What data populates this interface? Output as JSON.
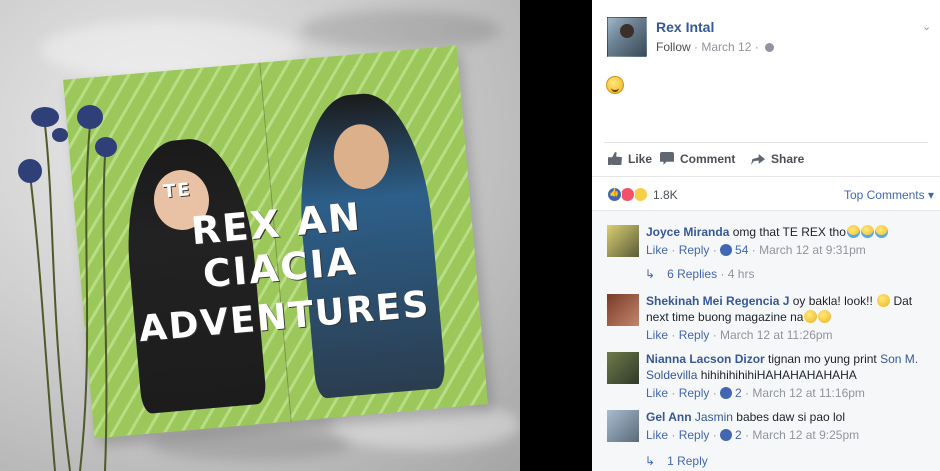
{
  "photo": {
    "magazine_title_line1": "TE",
    "magazine_title_line2": "REX AN CIACIA",
    "magazine_title_line3": "ADVENTURES"
  },
  "post": {
    "author": "Rex Intal",
    "follow_label": "Follow",
    "separator": "·",
    "date": "March 12",
    "body_emoji": "smiley-face"
  },
  "actions": {
    "like": "Like",
    "comment": "Comment",
    "share": "Share"
  },
  "reactions": {
    "count": "1.8K",
    "types": [
      "like",
      "love",
      "wow"
    ],
    "sort_label": "Top Comments"
  },
  "comments": [
    {
      "name": "Joyce Miranda",
      "text": "omg that TE REX tho",
      "emojis": [
        "crying-laughing",
        "crying-laughing",
        "crying-laughing"
      ],
      "like": "Like",
      "reply": "Reply",
      "likes": "54",
      "time": "March 12 at 9:31pm",
      "replies_label": "6 Replies",
      "replies_time": "4 hrs"
    },
    {
      "name": "Shekinah Mei Regencia J",
      "text_before": "oy bakla! look!!",
      "text_after": "Dat next time buong magazine na",
      "like": "Like",
      "reply": "Reply",
      "time": "March 12 at 11:26pm"
    },
    {
      "name": "Nianna Lacson Dizor",
      "text": "tignan mo yung print",
      "mention": "Son M. Soldevilla",
      "text_after": "hihihihihihiHAHAHAHAHAHA",
      "like": "Like",
      "reply": "Reply",
      "likes": "2",
      "time": "March 12 at 11:16pm"
    },
    {
      "name": "Gel Ann",
      "mention": "Jasmin",
      "text": "babes daw si pao lol",
      "like": "Like",
      "reply": "Reply",
      "likes": "2",
      "time": "March 12 at 9:25pm",
      "replies_label": "1 Reply"
    }
  ],
  "colors": {
    "link": "#365899",
    "accent": "#4267b2",
    "muted": "#90949c",
    "panel_bg": "#f6f7f9"
  }
}
